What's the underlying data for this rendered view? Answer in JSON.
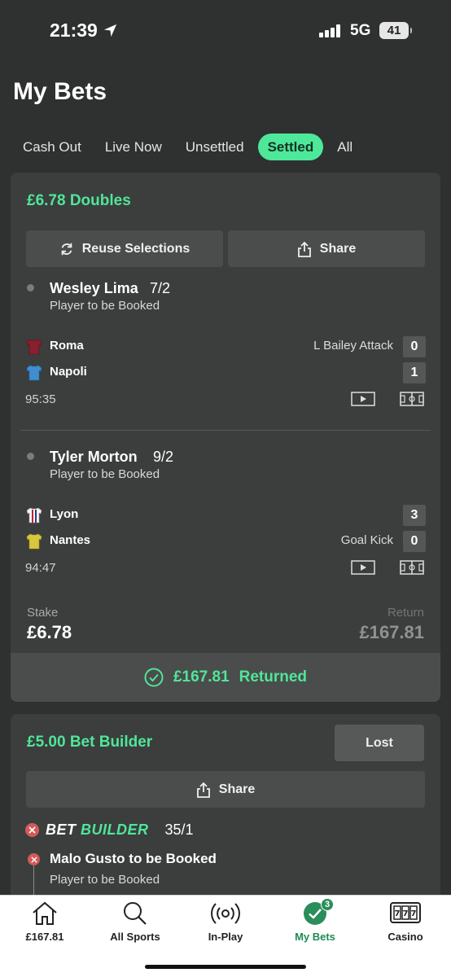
{
  "status_bar": {
    "time": "21:39",
    "network": "5G",
    "battery": "41"
  },
  "page": {
    "title": "My Bets"
  },
  "tabs": [
    {
      "label": "Cash Out"
    },
    {
      "label": "Live Now"
    },
    {
      "label": "Unsettled"
    },
    {
      "label": "Settled",
      "active": true
    },
    {
      "label": "All"
    }
  ],
  "bet1": {
    "title": "£6.78 Doubles",
    "reuse_label": "Reuse Selections",
    "share_label": "Share",
    "selections": [
      {
        "player": "Wesley Lima",
        "odds": "7/2",
        "market": "Player to be Booked",
        "home_team": "Roma",
        "away_team": "Napoli",
        "home_extra": "L Bailey Attack",
        "away_extra": "",
        "home_score": "0",
        "away_score": "1",
        "time": "95:35"
      },
      {
        "player": "Tyler Morton",
        "odds": "9/2",
        "market": "Player to be Booked",
        "home_team": "Lyon",
        "away_team": "Nantes",
        "home_extra": "",
        "away_extra": "Goal Kick",
        "home_score": "3",
        "away_score": "0",
        "time": "94:47"
      }
    ],
    "stake_label": "Stake",
    "stake_value": "£6.78",
    "return_label": "Return",
    "return_value": "£167.81",
    "returned_amount": "£167.81",
    "returned_text": "Returned"
  },
  "bet2": {
    "title": "£5.00 Bet Builder",
    "status": "Lost",
    "share_label": "Share",
    "builder_word1": "BET",
    "builder_word2": "BUILDER",
    "odds": "35/1",
    "leg_title": "Malo Gusto to be Booked",
    "leg_market": "Player to be Booked"
  },
  "bottom_nav": [
    {
      "label": "£167.81",
      "icon": "home-icon"
    },
    {
      "label": "All Sports",
      "icon": "search-icon"
    },
    {
      "label": "In-Play",
      "icon": "live-icon"
    },
    {
      "label": "My Bets",
      "icon": "check-circle-icon",
      "badge": "3",
      "active": true
    },
    {
      "label": "Casino",
      "icon": "slot-machine-icon"
    }
  ],
  "colors": {
    "accent": "#50e59a",
    "background": "#2f3130",
    "card": "#3b3e3c",
    "lost_red": "#d45a5a"
  }
}
